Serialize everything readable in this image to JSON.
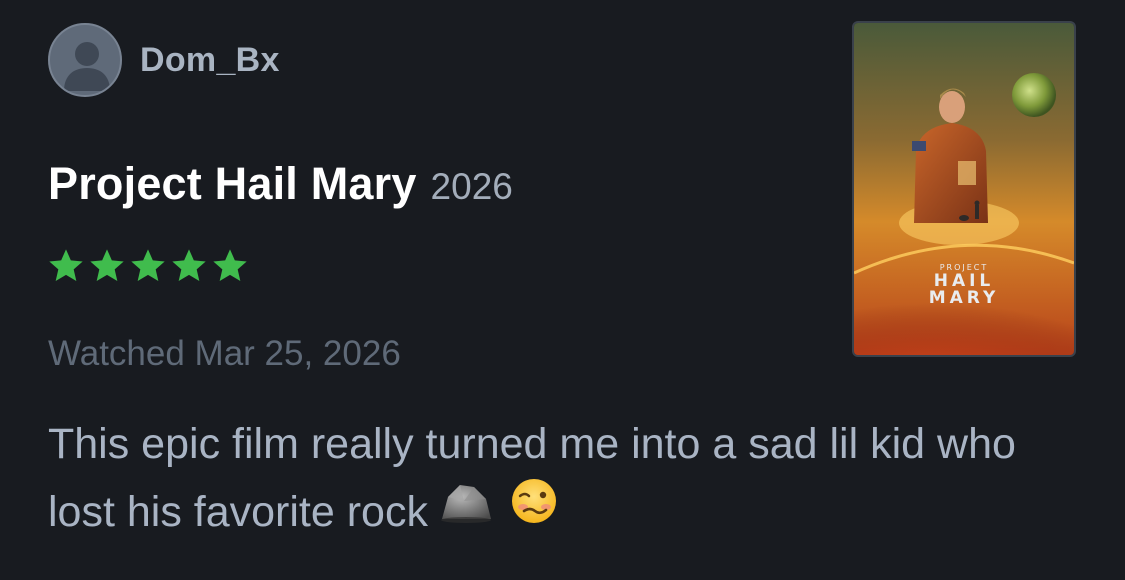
{
  "user": {
    "username": "Dom_Bx",
    "avatar_icon": "person-silhouette-icon"
  },
  "film": {
    "title": "Project Hail Mary",
    "year": "2026",
    "rating_stars": 5,
    "rating_max": 5,
    "star_color": "#40bc4d",
    "poster": {
      "top_text": "PROJECT",
      "line1": "HAIL",
      "line2": "MARY"
    }
  },
  "watched": "Watched Mar 25, 2026",
  "review": {
    "text": "This epic film really turned me into a sad lil kid who lost his favorite rock",
    "emojis": [
      "rock-emoji",
      "woozy-face-emoji"
    ]
  },
  "colors": {
    "background": "#181b20",
    "username": "#a9b4c2",
    "title": "#ffffff",
    "muted": "#5f6a78",
    "body": "#a9b4c4"
  }
}
